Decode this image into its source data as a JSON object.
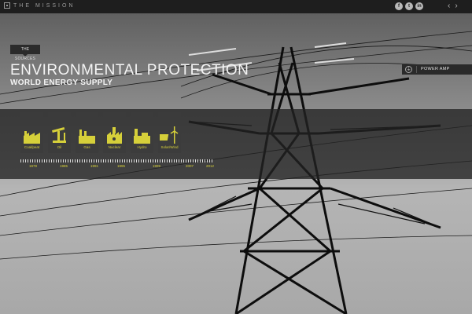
{
  "header": {
    "brand": "THE MISSION",
    "social": [
      {
        "icon": "facebook-icon",
        "glyph": "f"
      },
      {
        "icon": "twitter-icon",
        "glyph": "t"
      },
      {
        "icon": "linkedin-icon",
        "glyph": "in"
      }
    ],
    "nav_prev": "‹",
    "nav_next": "›"
  },
  "section": {
    "tag": "THE SOURCES",
    "title": "ENVIRONMENTAL PROTECTION",
    "subtitle": "WORLD ENERGY SUPPLY"
  },
  "power_amp": {
    "icon": "power-pylon-icon",
    "glyph": "⍊",
    "label": "POWER AMP"
  },
  "sources": [
    {
      "label": "Coal/peat",
      "icon": "factory-icon"
    },
    {
      "label": "Oil",
      "icon": "oil-pump-icon"
    },
    {
      "label": "Gas",
      "icon": "gas-plant-icon"
    },
    {
      "label": "Nuclear",
      "icon": "nuclear-plant-icon"
    },
    {
      "label": "Hydro",
      "icon": "hydro-plant-icon"
    },
    {
      "label": "Solar/Wind",
      "icon": "solar-wind-icon"
    }
  ],
  "timeline": {
    "years": [
      "1979",
      "1985",
      "1991",
      "1995",
      "1999",
      "2007",
      "2012"
    ]
  },
  "colors": {
    "accent": "#d6d03a",
    "bar": "#1e1e1e"
  }
}
